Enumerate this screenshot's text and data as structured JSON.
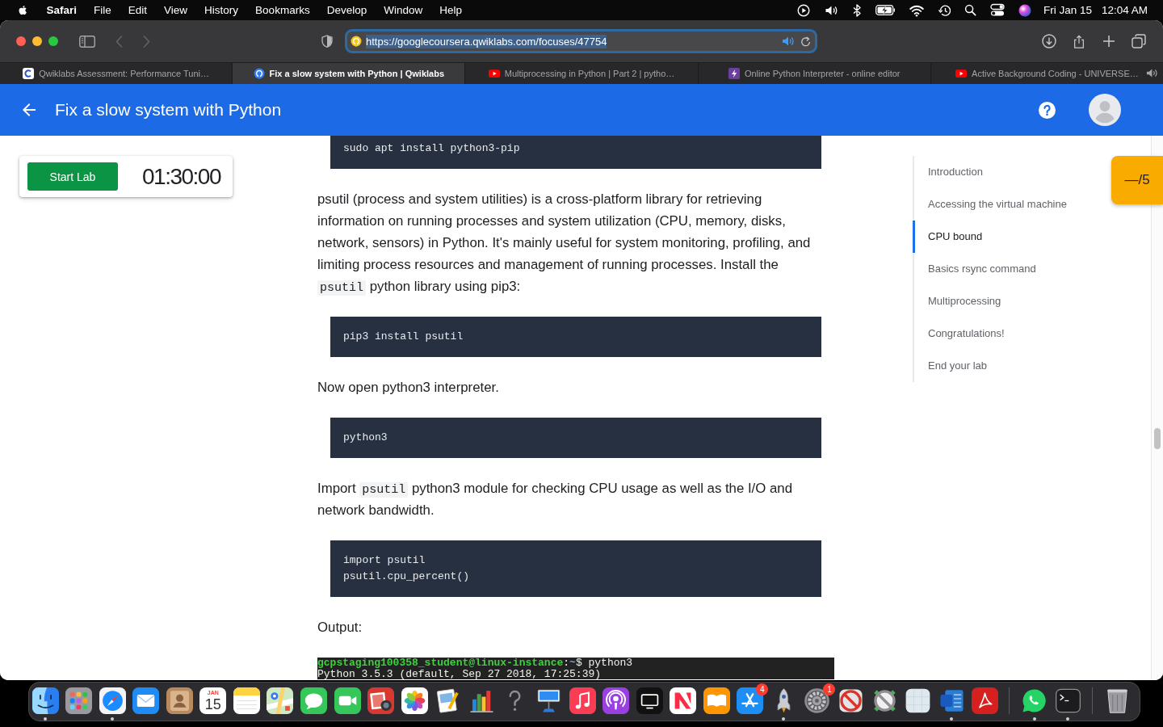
{
  "menu_bar": {
    "app_name": "Safari",
    "menus": [
      "File",
      "Edit",
      "View",
      "History",
      "Bookmarks",
      "Develop",
      "Window",
      "Help"
    ],
    "date": "Fri Jan 15",
    "time": "12:04 AM"
  },
  "toolbar": {
    "nav": [
      {
        "kind": "back",
        "disabled": true
      },
      {
        "kind": "forward",
        "disabled": true
      }
    ],
    "address": {
      "url": "https://googlecoursera.qwiklabs.com/focuses/47754",
      "focused": true,
      "text_selected": true,
      "audio": true
    }
  },
  "tabs": [
    {
      "kind": "arc",
      "title": "Qwiklabs Assessment: Performance Tuni…",
      "selected": false,
      "audio": false
    },
    {
      "kind": "ring",
      "title": "Fix a slow system with Python | Qwiklabs",
      "selected": true,
      "audio": false
    },
    {
      "kind": "play",
      "title": "Multiprocessing in Python | Part 2 | pytho…",
      "selected": false,
      "audio": false
    },
    {
      "kind": "bolt",
      "title": "Online Python Interpreter - online editor",
      "selected": false,
      "audio": false
    },
    {
      "kind": "play",
      "title": "Active Background Coding - UNIVERSE…",
      "selected": false,
      "audio": true
    }
  ],
  "header": {
    "title": "Fix a slow system with Python"
  },
  "lab_card": {
    "button": "Start Lab",
    "timer": "01:30:00"
  },
  "content": [
    {
      "kind": "code",
      "lines": [
        "sudo apt install python3-pip"
      ]
    },
    {
      "kind": "paragraph",
      "parts": [
        {
          "kind": "text",
          "text": "psutil (process and system utilities) is a cross-platform library for retrieving information on running processes and system utilization (CPU, memory, disks, network, sensors) in Python. It's mainly useful for system monitoring, profiling, and limiting process resources and management of running processes. Install the "
        },
        {
          "kind": "code",
          "text": "psutil"
        },
        {
          "kind": "text",
          "text": " python library using pip3:"
        }
      ]
    },
    {
      "kind": "code",
      "lines": [
        "pip3 install psutil"
      ]
    },
    {
      "kind": "paragraph",
      "parts": [
        {
          "kind": "text",
          "text": "Now open python3 interpreter."
        }
      ]
    },
    {
      "kind": "code",
      "lines": [
        "python3"
      ]
    },
    {
      "kind": "paragraph",
      "parts": [
        {
          "kind": "text",
          "text": "Import "
        },
        {
          "kind": "code",
          "text": "psutil"
        },
        {
          "kind": "text",
          "text": " python3 module for checking CPU usage as well as the I/O and network bandwidth."
        }
      ]
    },
    {
      "kind": "code",
      "lines": [
        "import psutil",
        "psutil.cpu_percent()"
      ]
    },
    {
      "kind": "paragraph",
      "parts": [
        {
          "kind": "text",
          "text": "Output:"
        }
      ]
    },
    {
      "kind": "terminal",
      "lines": [
        [
          {
            "kind": "user",
            "text": "gcpstaging100358_student@linux-instance"
          },
          {
            "kind": "plain",
            "text": ":"
          },
          {
            "kind": "path",
            "text": "~"
          },
          {
            "kind": "plain",
            "text": "$ python3"
          }
        ],
        [
          {
            "kind": "plain",
            "text": "Python 3.5.3 (default, Sep 27 2018, 17:25:39)"
          }
        ]
      ]
    }
  ],
  "toc": [
    {
      "label": "Introduction",
      "selected": false
    },
    {
      "label": "Accessing the virtual machine",
      "selected": false
    },
    {
      "label": "CPU bound",
      "selected": true
    },
    {
      "label": "Basics rsync command",
      "selected": false
    },
    {
      "label": "Multiprocessing",
      "selected": false
    },
    {
      "label": "Congratulations!",
      "selected": false
    },
    {
      "label": "End your lab",
      "selected": false
    }
  ],
  "score": "—/5",
  "dock": {
    "sections": [
      [
        {
          "kind": "face",
          "running": true
        },
        {
          "kind": "grid",
          "running": false
        },
        {
          "kind": "compass",
          "running": true
        },
        {
          "kind": "envelope",
          "running": false
        },
        {
          "kind": "contacts",
          "running": false
        },
        {
          "kind": "calendar",
          "running": false,
          "month": "JAN",
          "day": "15"
        },
        {
          "kind": "notes",
          "running": false
        },
        {
          "kind": "map",
          "running": false
        },
        {
          "kind": "chat",
          "running": false
        },
        {
          "kind": "video",
          "running": false
        },
        {
          "kind": "photobooth",
          "running": false
        },
        {
          "kind": "flower",
          "running": false
        },
        {
          "kind": "preview",
          "running": false
        },
        {
          "kind": "chart",
          "running": false
        },
        {
          "kind": "question",
          "running": false
        },
        {
          "kind": "podium",
          "running": false
        },
        {
          "kind": "note",
          "running": false
        },
        {
          "kind": "podcast",
          "running": false
        },
        {
          "kind": "tv",
          "running": false
        },
        {
          "kind": "news",
          "running": false
        },
        {
          "kind": "book",
          "running": false
        },
        {
          "kind": "store",
          "running": false,
          "badge": "4"
        },
        {
          "kind": "rocket",
          "running": true
        },
        {
          "kind": "gear",
          "running": false,
          "badge": "1"
        },
        {
          "kind": "blocked",
          "running": false
        },
        {
          "kind": "blocked2",
          "running": false
        },
        {
          "kind": "blank",
          "running": false
        },
        {
          "kind": "word",
          "running": true
        },
        {
          "kind": "pdf",
          "running": false
        }
      ],
      [
        {
          "kind": "phone",
          "running": true
        },
        {
          "kind": "terminal",
          "running": true
        }
      ],
      [
        {
          "kind": "trash",
          "running": false
        }
      ]
    ]
  }
}
